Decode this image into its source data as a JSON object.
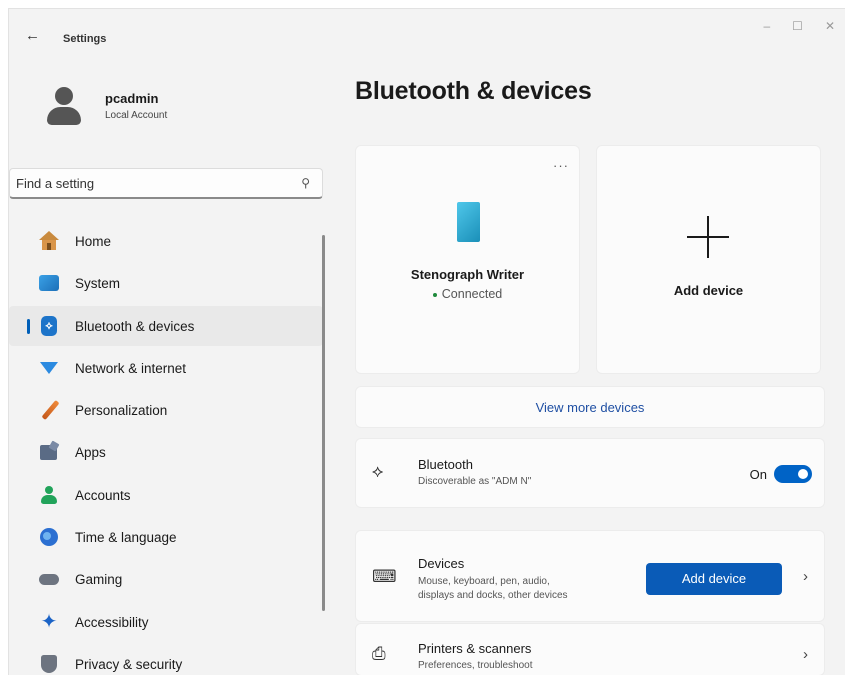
{
  "window": {
    "title": "Settings",
    "controls": {
      "minimize": "–",
      "maximize": "☐",
      "close": "✕"
    }
  },
  "user": {
    "name": "pcadmin",
    "account_type": "Local Account"
  },
  "search": {
    "placeholder": "Find a setting",
    "icon": "search-icon"
  },
  "nav": {
    "items": [
      {
        "label": "Home",
        "icon": "home-icon"
      },
      {
        "label": "System",
        "icon": "system-icon"
      },
      {
        "label": "Bluetooth & devices",
        "icon": "bluetooth-icon",
        "active": true
      },
      {
        "label": "Network & internet",
        "icon": "network-icon"
      },
      {
        "label": "Personalization",
        "icon": "brush-icon"
      },
      {
        "label": "Apps",
        "icon": "apps-icon"
      },
      {
        "label": "Accounts",
        "icon": "accounts-icon"
      },
      {
        "label": "Time & language",
        "icon": "globe-icon"
      },
      {
        "label": "Gaming",
        "icon": "gamepad-icon"
      },
      {
        "label": "Accessibility",
        "icon": "accessibility-icon"
      },
      {
        "label": "Privacy & security",
        "icon": "shield-icon"
      }
    ]
  },
  "main": {
    "title": "Bluetooth & devices",
    "device_card": {
      "more": "···",
      "name": "Stenograph Writer",
      "status": "Connected"
    },
    "add_device_card": {
      "label": "Add device"
    },
    "view_more": "View more devices",
    "bluetooth_row": {
      "title": "Bluetooth",
      "subtitle": "Discoverable as \"ADM N\"",
      "toggle_label": "On",
      "toggle_on": true
    },
    "devices_row": {
      "title": "Devices",
      "subtitle_line1": "Mouse, keyboard, pen, audio,",
      "subtitle_line2": "displays and docks, other devices",
      "button": "Add device"
    },
    "printers_row": {
      "title": "Printers & scanners",
      "subtitle": "Preferences, troubleshoot"
    }
  },
  "colors": {
    "accent": "#0063c6",
    "button": "#0a5bb7",
    "link": "#1f4fa3",
    "background": "#f3f3f3",
    "card": "#fbfbfb"
  }
}
